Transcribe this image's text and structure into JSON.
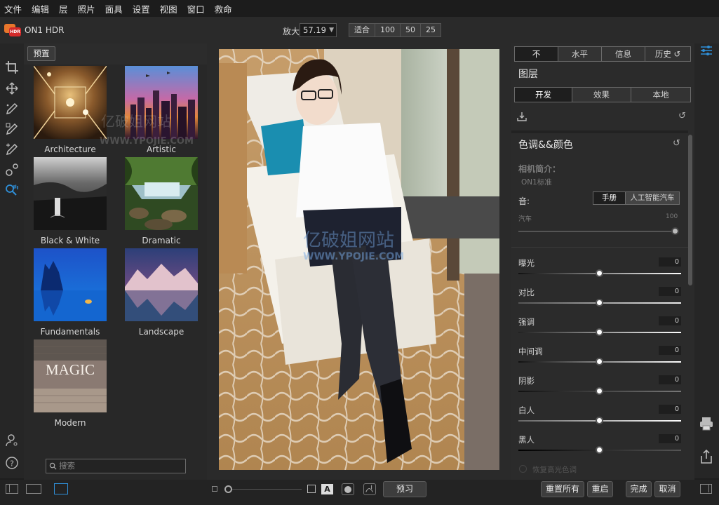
{
  "menu": [
    "文件",
    "编辑",
    "层",
    "照片",
    "面具",
    "设置",
    "视图",
    "窗口",
    "救命"
  ],
  "app": {
    "title": "ON1 HDR",
    "logo_text": "HDR"
  },
  "zoom": {
    "label": "放大",
    "value": "57.19",
    "buttons": [
      "适合",
      "100",
      "50",
      "25"
    ]
  },
  "browser": {
    "tab_label": "预置",
    "presets": [
      "Architecture",
      "Artistic",
      "Black & White",
      "Dramatic",
      "Fundamentals",
      "Landscape",
      "Modern"
    ],
    "modern_thumb_text": "MAGIC",
    "search_placeholder": "搜索"
  },
  "watermark": {
    "text": "亿破姐网站",
    "url": "WWW.YPOJIE.COM"
  },
  "right": {
    "top_tabs": [
      "不",
      "水平",
      "信息",
      "历史"
    ],
    "layers_title": "图层",
    "sub_tabs": [
      "开发",
      "效果",
      "本地"
    ],
    "section_title": "色调&&颜色",
    "camera_profile_label": "相机简介：",
    "camera_profile_value": "ON1标准",
    "tone_label": "音:",
    "tone_modes": [
      "手册",
      "人工智能汽车"
    ],
    "auto_label": "汽车",
    "auto_value": "100",
    "sliders": [
      {
        "label": "曝光",
        "value": "0"
      },
      {
        "label": "对比",
        "value": "0"
      },
      {
        "label": "强调",
        "value": "0"
      },
      {
        "label": "中间调",
        "value": "0"
      },
      {
        "label": "阴影",
        "value": "0"
      },
      {
        "label": "白人",
        "value": "0"
      },
      {
        "label": "黑人",
        "value": "0"
      }
    ],
    "recover_label": "恢复高光色调"
  },
  "bottom": {
    "preview_label": "预习",
    "reset_all_label": "重置所有",
    "restart_label": "重启",
    "done_label": "完成",
    "cancel_label": "取消",
    "text_overlay_glyph": "A"
  },
  "colors": {
    "accent_blue": "#2f8fd8",
    "orange": "#e8762c",
    "red": "#d42a2a"
  }
}
